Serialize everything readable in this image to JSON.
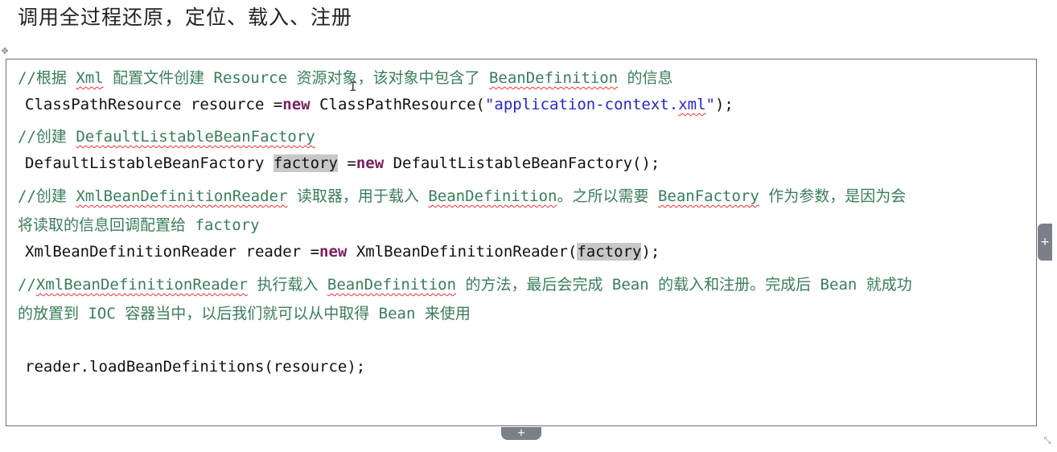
{
  "heading": "调用全过程还原，定位、载入、注册",
  "code": {
    "c1_a": "//根据 ",
    "c1_b": "Xml",
    "c1_c": " 配置文件创建 Resource 资源对象，该对象中包含了 ",
    "c1_d": "BeanDefinition",
    "c1_e": " 的信息",
    "l2_a": "ClassPathResource resource =",
    "l2_kw": "new",
    "l2_b": " ClassPathResource(",
    "l2_str": "\"application-context.",
    "l2_str2": "xml",
    "l2_str3": "\"",
    "l2_c": ");",
    "c3_a": "//创建 ",
    "c3_b": "DefaultListableBeanFactory",
    "l4_a": "DefaultListableBeanFactory ",
    "l4_hl": "factory",
    "l4_b": " =",
    "l4_kw": "new",
    "l4_c": " DefaultListableBeanFactory();",
    "c5_a": "//创建 ",
    "c5_b": "XmlBeanDefinitionReader",
    "c5_c": " 读取器，用于载入 ",
    "c5_d": "BeanDefinition",
    "c5_e": "。之所以需要 ",
    "c5_f": "BeanFactory",
    "c5_g": " 作为参数，是因为会",
    "c6": "将读取的信息回调配置给 factory",
    "l7_a": "XmlBeanDefinitionReader reader =",
    "l7_kw": "new",
    "l7_b": " XmlBeanDefinitionReader(",
    "l7_hl": "factory",
    "l7_c": ");",
    "c8_a": "//",
    "c8_b": "XmlBeanDefinitionReader",
    "c8_c": " 执行载入 ",
    "c8_d": "BeanDefinition",
    "c8_e": " 的方法，最后会完成 Bean 的载入和注册。完成后 Bean 就成功",
    "c9": "的放置到 IOC 容器当中，以后我们就可以从中取得 Bean 来使用",
    "l10": "reader.loadBeanDefinitions(resource);"
  },
  "handles": {
    "move": "✥",
    "resize": "⤡",
    "side_tab": "+",
    "bottom_tab": "+"
  }
}
